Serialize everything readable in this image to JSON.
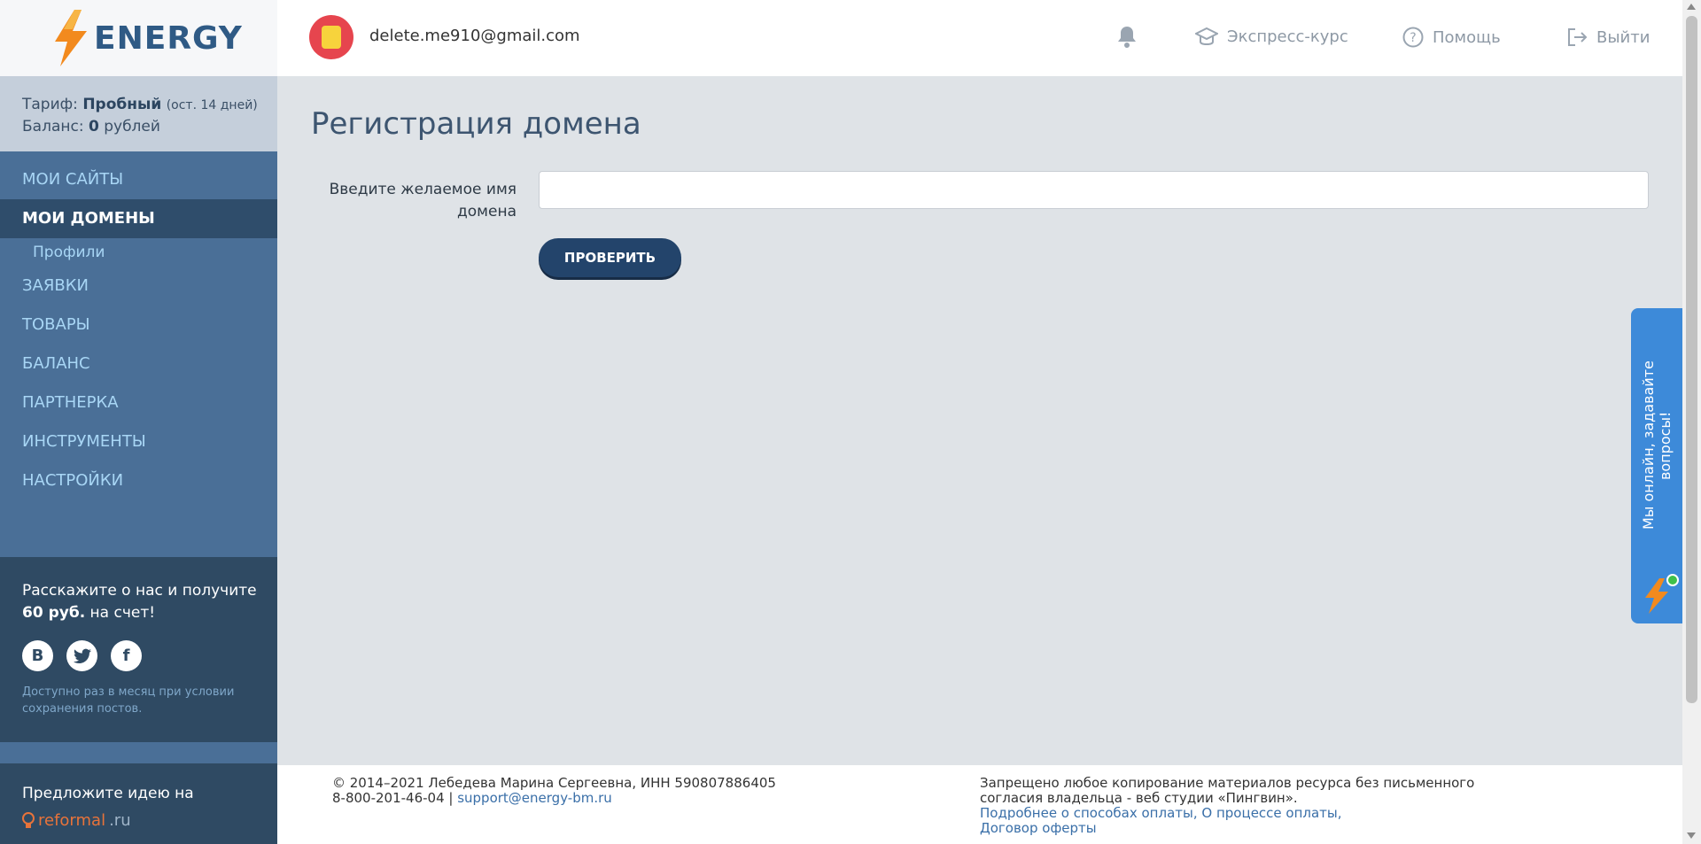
{
  "logo": {
    "text": "ENERGY"
  },
  "account": {
    "tariff_label": "Тариф: ",
    "tariff_value": "Пробный",
    "tariff_note": "(ост. 14 дней)",
    "balance_label": "Баланс: ",
    "balance_value": "0",
    "balance_unit": " рублей"
  },
  "nav": {
    "items": [
      {
        "label": "МОИ САЙТЫ"
      },
      {
        "label": "МОИ ДОМЕНЫ"
      },
      {
        "label": "Профили"
      },
      {
        "label": "ЗАЯВКИ"
      },
      {
        "label": "ТОВАРЫ"
      },
      {
        "label": "БАЛАНС"
      },
      {
        "label": "ПАРТНЕРКА"
      },
      {
        "label": "ИНСТРУМЕНТЫ"
      },
      {
        "label": "НАСТРОЙКИ"
      }
    ]
  },
  "share": {
    "line1": "Расскажите о нас и получите",
    "amount": "60 руб.",
    "line2_rest": " на счет!",
    "note": "Доступно раз в месяц при условии сохранения постов."
  },
  "idea": {
    "text": "Предложите идею на",
    "brand": "reformal",
    "tld": ".ru"
  },
  "header": {
    "email": "delete.me910@gmail.com",
    "express": "Экспресс-курс",
    "help": "Помощь",
    "logout": "Выйти"
  },
  "main": {
    "title": "Регистрация домена",
    "domain_label": "Введите желаемое имя домена",
    "domain_value": "",
    "check_button": "ПРОВЕРИТЬ"
  },
  "chat": {
    "text": "Мы онлайн, задавайте вопросы!"
  },
  "footer": {
    "copyright": "© 2014–2021 Лебедева Марина Сергеевна, ИНН 590807886405",
    "phone": "8-800-201-46-04 | ",
    "support_email": "support@energy-bm.ru",
    "notice": "Запрещено любое копирование материалов ресурса без письменного согласия владельца - веб студии «Пингвин».",
    "payment_methods": "Подробнее о способах оплаты,",
    "payment_process": "О процессе оплаты,",
    "offer": "Договор оферты"
  },
  "colors": {
    "accent": "#23446b",
    "sidebar": "#4a6f97",
    "chat": "#3d8ad9"
  }
}
